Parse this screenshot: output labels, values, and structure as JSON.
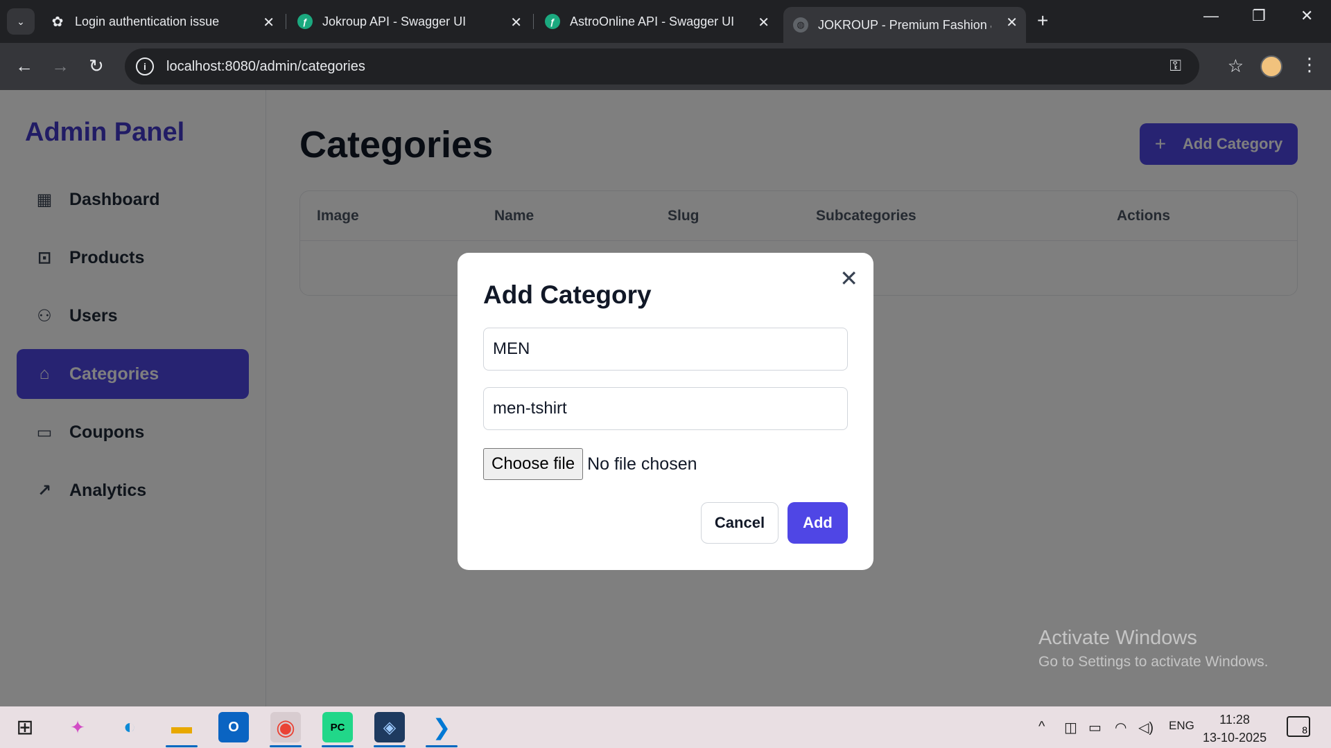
{
  "browser": {
    "tabs": [
      {
        "title": "Login authentication issue",
        "icon": "openai-icon"
      },
      {
        "title": "Jokroup API - Swagger UI",
        "icon": "swagger-icon"
      },
      {
        "title": "AstroOnline API - Swagger UI",
        "icon": "swagger-icon"
      },
      {
        "title": "JOKROUP - Premium Fashion &",
        "icon": "globe-icon"
      }
    ],
    "url": "localhost:8080/admin/categories"
  },
  "sidebar": {
    "brand": "Admin Panel",
    "items": [
      {
        "label": "Dashboard",
        "icon": "dashboard-icon"
      },
      {
        "label": "Products",
        "icon": "shopping-bag-icon"
      },
      {
        "label": "Users",
        "icon": "users-icon"
      },
      {
        "label": "Categories",
        "icon": "tag-icon"
      },
      {
        "label": "Coupons",
        "icon": "ticket-icon"
      },
      {
        "label": "Analytics",
        "icon": "trending-up-icon"
      }
    ]
  },
  "main": {
    "title": "Categories",
    "add_button": "Add Category",
    "table_headers": [
      "Image",
      "Name",
      "Slug",
      "Subcategories",
      "Actions"
    ]
  },
  "modal": {
    "title": "Add Category",
    "name_value": "MEN",
    "slug_value": "men-tshirt",
    "file_button": "Choose file",
    "file_status": "No file chosen",
    "cancel_label": "Cancel",
    "add_label": "Add"
  },
  "watermark": {
    "line1": "Activate Windows",
    "line2": "Go to Settings to activate Windows."
  },
  "taskbar": {
    "lang": "ENG",
    "time": "11:28",
    "date": "13-10-2025",
    "notifications": "8"
  },
  "colors": {
    "accent": "#4f46e5",
    "browser_dark": "#202124"
  }
}
